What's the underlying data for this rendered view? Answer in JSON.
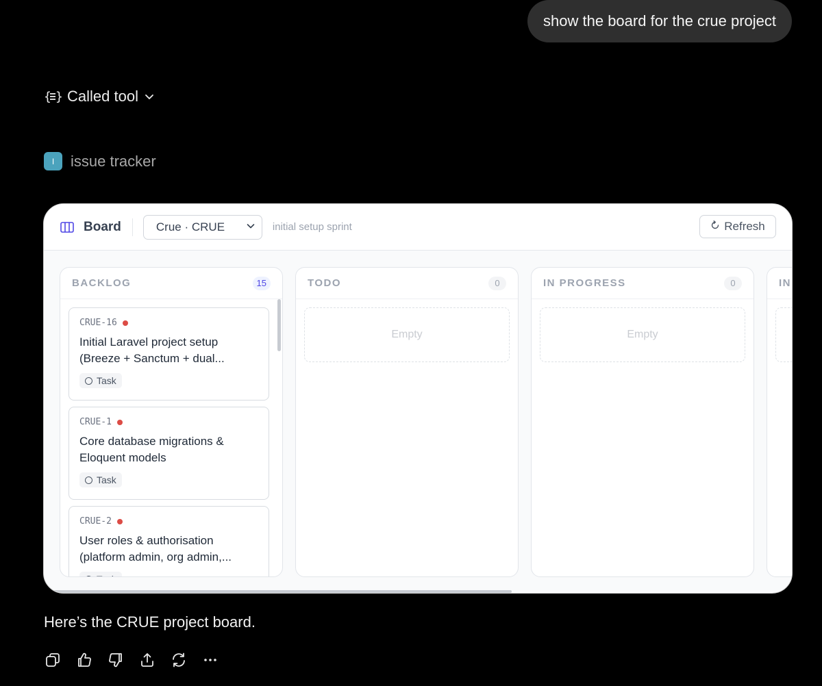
{
  "user_message": "show the board for the crue project",
  "tool_call": {
    "label": "Called tool"
  },
  "app": {
    "badge": "I",
    "name": "issue tracker"
  },
  "widget": {
    "header": {
      "title": "Board",
      "project_select": "Crue · CRUE",
      "sprint": "initial setup sprint",
      "refresh_label": "Refresh"
    },
    "columns": [
      {
        "title": "BACKLOG",
        "count": "15",
        "cards": [
          {
            "key": "CRUE-16",
            "title_line1": "Initial Laravel project setup",
            "title_line2": "(Breeze + Sanctum + dual...",
            "type": "Task"
          },
          {
            "key": "CRUE-1",
            "title_line1": "Core database migrations &",
            "title_line2": "Eloquent models",
            "type": "Task"
          },
          {
            "key": "CRUE-2",
            "title_line1": "User roles & authorisation",
            "title_line2": "(platform admin, org admin,...",
            "type": "Task"
          }
        ]
      },
      {
        "title": "TODO",
        "count": "0",
        "empty_label": "Empty"
      },
      {
        "title": "IN PROGRESS",
        "count": "0",
        "empty_label": "Empty"
      },
      {
        "title": "IN"
      }
    ]
  },
  "reply": "Here’s the CRUE project board.",
  "colors": {
    "accent_count": "#4f46e5",
    "priority_high": "#dc4c46",
    "app_badge": "#4ba3bd"
  },
  "action_icons": [
    "copy-icon",
    "thumbs-up-icon",
    "thumbs-down-icon",
    "share-icon",
    "regenerate-icon",
    "more-icon"
  ]
}
